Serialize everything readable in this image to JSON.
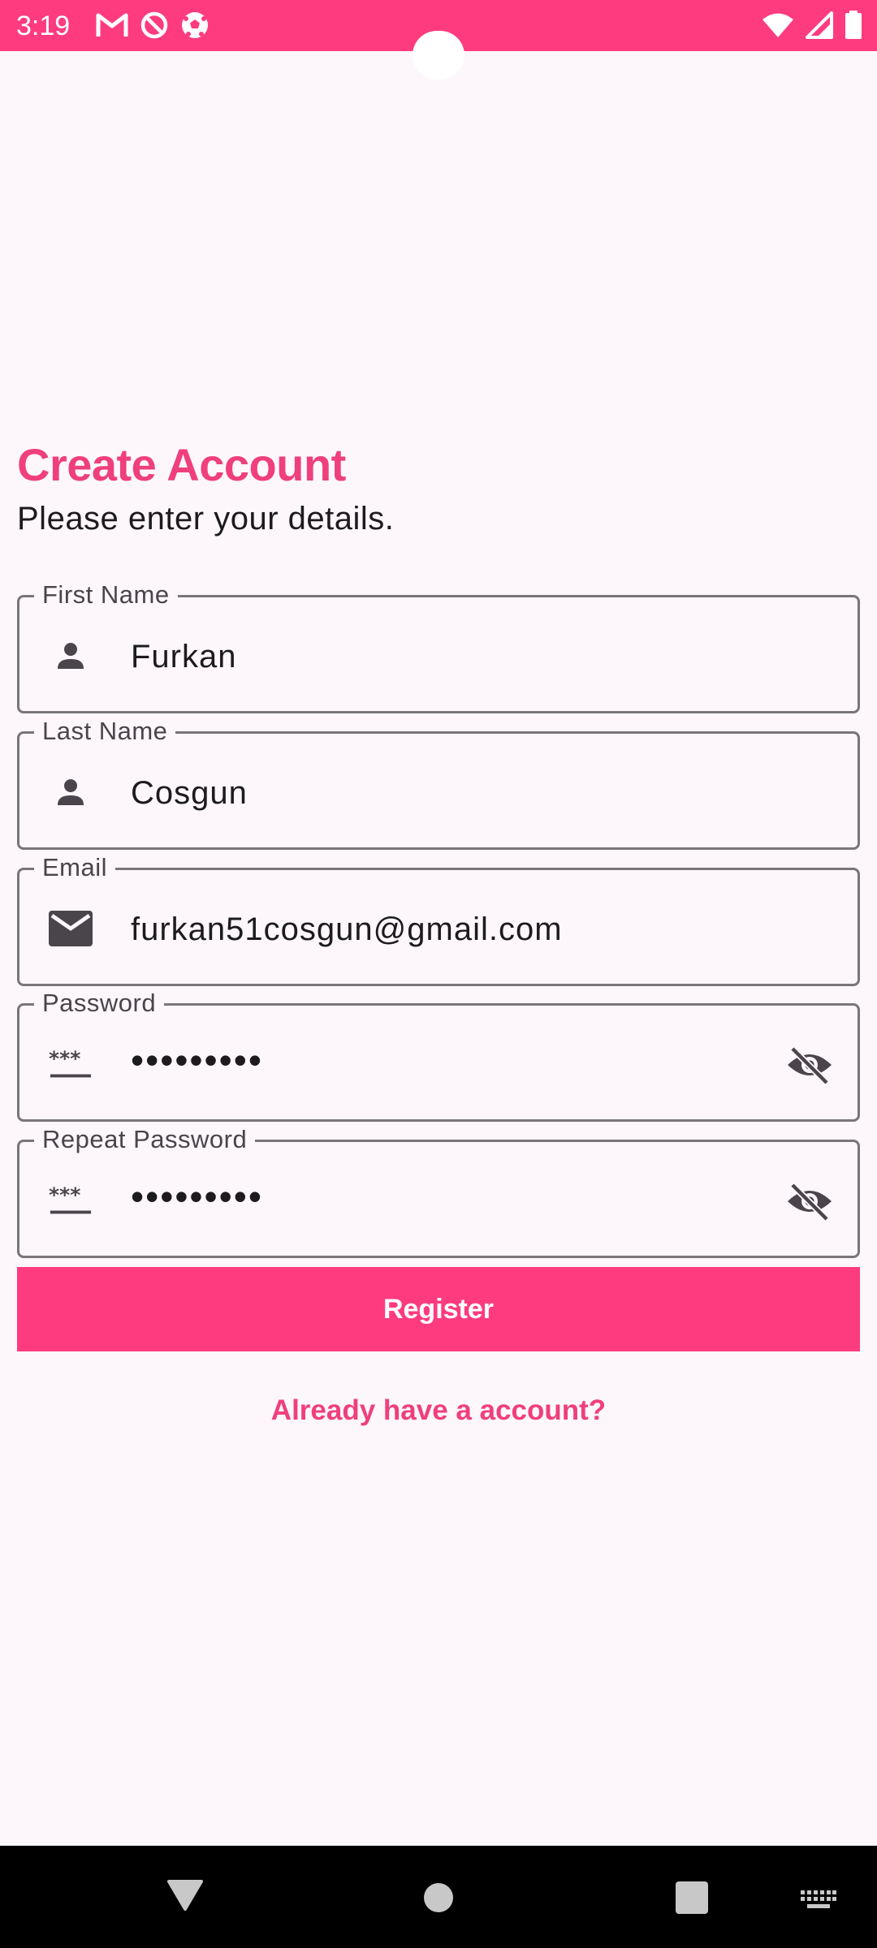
{
  "status_bar": {
    "time": "3:19",
    "left_icons": [
      "gmail-icon",
      "do-not-disturb-icon",
      "football-icon"
    ],
    "right_icons": [
      "wifi-icon",
      "signal-icon",
      "battery-icon"
    ]
  },
  "header": {
    "title": "Create Account",
    "subtitle": "Please enter your details."
  },
  "form": {
    "first_name": {
      "label": "First Name",
      "value": "Furkan",
      "icon": "person-icon"
    },
    "last_name": {
      "label": "Last Name",
      "value": "Cosgun",
      "icon": "person-icon"
    },
    "email": {
      "label": "Email",
      "value": "furkan51cosgun@gmail.com",
      "icon": "mail-icon"
    },
    "password": {
      "label": "Password",
      "value": "•••••••••",
      "icon": "password-icon",
      "toggle_icon": "visibility-off-icon"
    },
    "repeat_password": {
      "label": "Repeat Password",
      "value": "•••••••••",
      "icon": "password-icon",
      "toggle_icon": "visibility-off-icon"
    }
  },
  "actions": {
    "register_label": "Register",
    "login_link": "Already have a account?"
  },
  "nav_bar": {
    "buttons": [
      "back-icon",
      "home-icon",
      "recents-icon",
      "keyboard-icon"
    ]
  },
  "colors": {
    "accent": "#fe3b7f",
    "accent_text": "#ef3f7d",
    "background": "#fdf7fb",
    "outline": "#7a757a"
  }
}
